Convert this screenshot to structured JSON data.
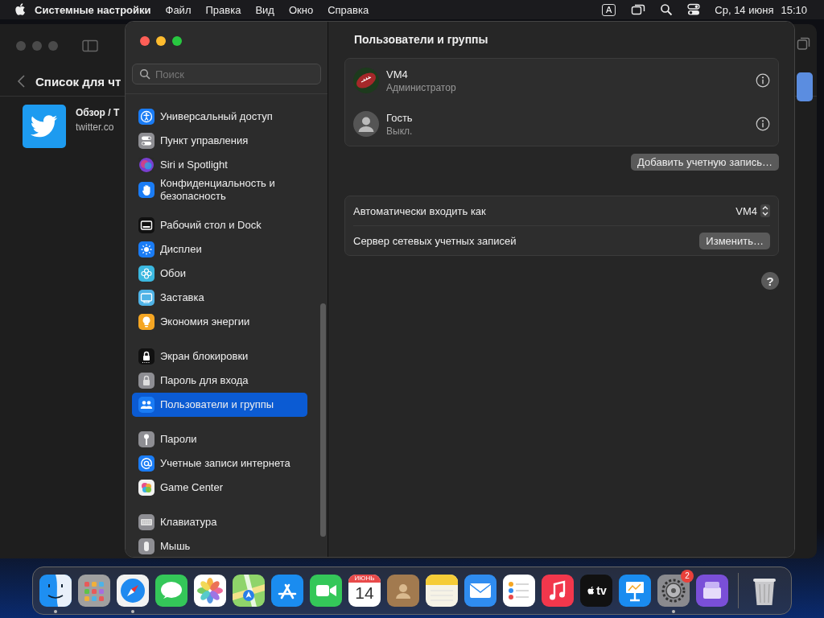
{
  "menu_bar": {
    "app_name": "Системные настройки",
    "menus": [
      "Файл",
      "Правка",
      "Вид",
      "Окно",
      "Справка"
    ],
    "input_source": "A",
    "date": "Ср, 14 июня",
    "time": "15:10"
  },
  "background_window": {
    "title": "Список для чт",
    "item": {
      "title": "Обзор / Т",
      "subtitle": "twitter.co"
    }
  },
  "settings_window": {
    "search": {
      "placeholder": "Поиск"
    },
    "sidebar": {
      "groups": [
        {
          "items": [
            {
              "label": "Универсальный доступ",
              "kind": "accessibility",
              "selected": false
            },
            {
              "label": "Пункт управления",
              "kind": "control-center",
              "selected": false
            },
            {
              "label": "Siri и Spotlight",
              "kind": "siri",
              "selected": false
            },
            {
              "label": "Конфиденциальность и безопасность",
              "kind": "privacy",
              "selected": false
            }
          ]
        },
        {
          "items": [
            {
              "label": "Рабочий стол и Dock",
              "kind": "desktop-dock",
              "selected": false
            },
            {
              "label": "Дисплеи",
              "kind": "displays",
              "selected": false
            },
            {
              "label": "Обои",
              "kind": "wallpaper",
              "selected": false
            },
            {
              "label": "Заставка",
              "kind": "screensaver",
              "selected": false
            },
            {
              "label": "Экономия энергии",
              "kind": "energy",
              "selected": false
            }
          ]
        },
        {
          "items": [
            {
              "label": "Экран блокировки",
              "kind": "lock-screen",
              "selected": false
            },
            {
              "label": "Пароль для входа",
              "kind": "login-password",
              "selected": false
            },
            {
              "label": "Пользователи и группы",
              "kind": "users",
              "selected": true
            }
          ]
        },
        {
          "items": [
            {
              "label": "Пароли",
              "kind": "passwords",
              "selected": false
            },
            {
              "label": "Учетные записи интернета",
              "kind": "internet-accounts",
              "selected": false
            },
            {
              "label": "Game Center",
              "kind": "game-center",
              "selected": false
            }
          ]
        },
        {
          "items": [
            {
              "label": "Клавиатура",
              "kind": "keyboard",
              "selected": false
            },
            {
              "label": "Мышь",
              "kind": "mouse",
              "selected": false
            }
          ]
        }
      ]
    },
    "pane": {
      "title": "Пользователи и группы",
      "users": [
        {
          "name": "VM4",
          "role": "Администратор",
          "kind": "football"
        },
        {
          "name": "Гость",
          "role": "Выкл.",
          "kind": "guest"
        }
      ],
      "add_button": "Добавить учетную запись…",
      "options": [
        {
          "kind": "popup",
          "label": "Автоматически входить как",
          "value": "VM4"
        },
        {
          "kind": "button",
          "label": "Сервер сетевых учетных записей",
          "button": "Изменить…"
        }
      ],
      "help_button": "?"
    }
  },
  "dock": {
    "apps": [
      {
        "kind": "finder",
        "running": true
      },
      {
        "kind": "launchpad",
        "running": false
      },
      {
        "kind": "safari",
        "running": true
      },
      {
        "kind": "messages",
        "running": false
      },
      {
        "kind": "photos",
        "running": false
      },
      {
        "kind": "maps",
        "running": false
      },
      {
        "kind": "app-store",
        "running": false
      },
      {
        "kind": "facetime",
        "running": false
      },
      {
        "kind": "calendar",
        "running": false,
        "month": "ИЮНЬ",
        "day": "14"
      },
      {
        "kind": "contacts",
        "running": false
      },
      {
        "kind": "notes",
        "running": false
      },
      {
        "kind": "mail",
        "running": false
      },
      {
        "kind": "reminders",
        "running": false
      },
      {
        "kind": "music",
        "running": false
      },
      {
        "kind": "tv",
        "running": false,
        "label": "tv"
      },
      {
        "kind": "keynote",
        "running": false
      },
      {
        "kind": "settings",
        "running": true,
        "badge": "2"
      },
      {
        "kind": "utility",
        "running": false
      }
    ],
    "trash": {
      "kind": "trash"
    }
  }
}
